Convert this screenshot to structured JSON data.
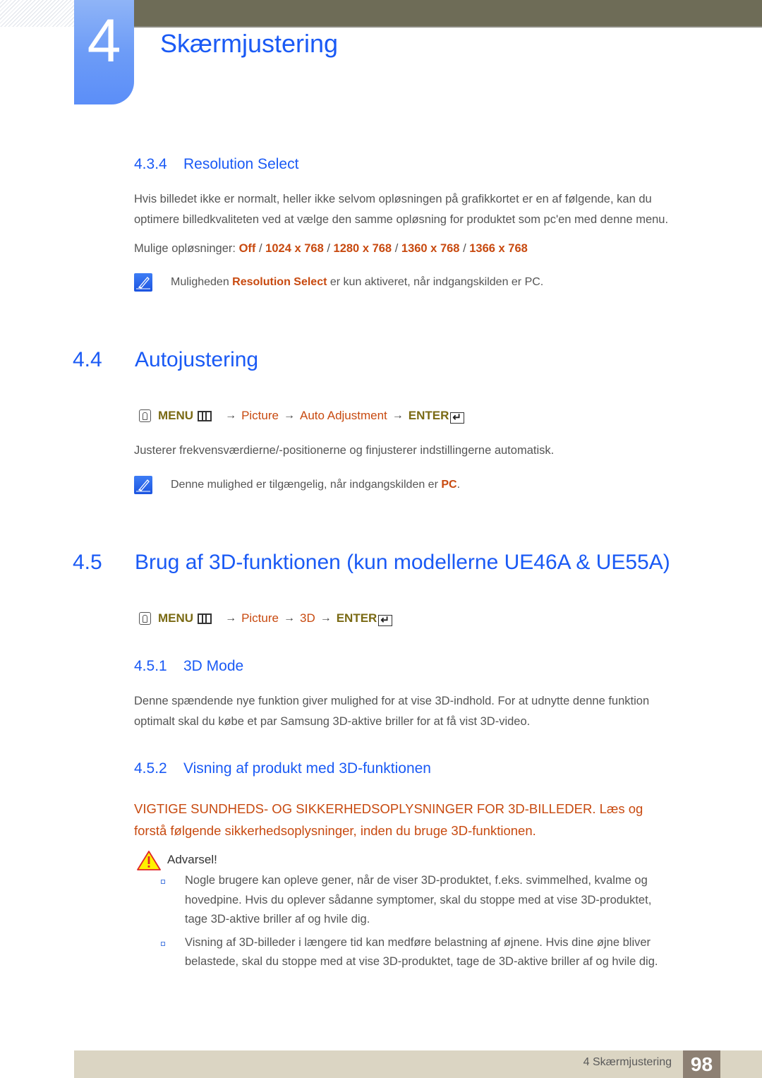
{
  "header": {
    "chapter_number": "4",
    "chapter_title": "Skærmjustering"
  },
  "section_434": {
    "number": "4.3.4",
    "title": "Resolution Select",
    "paragraph_line1": "Hvis billedet ikke er normalt, heller ikke selvom opløsningen på grafikkortet er en af følgende, kan du",
    "paragraph_line2": "optimere billedkvaliteten ved at vælge den samme opløsning for produktet som pc'en med denne menu.",
    "options_label": "Mulige opløsninger: ",
    "options": [
      "Off",
      "1024 x 768",
      "1280 x 768",
      "1360 x 768",
      "1366 x 768"
    ],
    "separator": " / ",
    "note": {
      "icon": "note-pencil-icon",
      "prefix": "Muligheden ",
      "highlight": "Resolution Select",
      "suffix": " er kun aktiveret, når indgangskilden er PC."
    }
  },
  "section_44": {
    "number": "4.4",
    "title": "Autojustering",
    "menu_path": {
      "menu": "MENU",
      "steps": [
        "Picture",
        "Auto Adjustment"
      ],
      "enter": "ENTER",
      "arrow": "→"
    },
    "paragraph": "Justerer frekvensværdierne/-positionerne og finjusterer indstillingerne automatisk.",
    "note": {
      "icon": "note-pencil-icon",
      "prefix": "Denne mulighed er tilgængelig, når indgangskilden er ",
      "highlight": "PC",
      "suffix": "."
    }
  },
  "section_45": {
    "number": "4.5",
    "title": "Brug af 3D-funktionen (kun modellerne UE46A & UE55A)",
    "menu_path": {
      "menu": "MENU",
      "steps": [
        "Picture",
        "3D"
      ],
      "enter": "ENTER",
      "arrow": "→"
    }
  },
  "section_451": {
    "number": "4.5.1",
    "title": "3D Mode",
    "paragraph_line1": "Denne spændende nye funktion giver mulighed for at vise 3D-indhold. For at udnytte denne funktion",
    "paragraph_line2": "optimalt skal du købe et par Samsung 3D-aktive briller for at få vist 3D-video."
  },
  "section_452": {
    "number": "4.5.2",
    "title": "Visning af produkt med 3D-funktionen",
    "warning_heading_line1": "VIGTIGE SUNDHEDS- OG SIKKERHEDSOPLYSNINGER FOR 3D-BILLEDER. Læs og",
    "warning_heading_line2": "forstå følgende sikkerhedsoplysninger, inden du bruge 3D-funktionen.",
    "caution_label": "Advarsel!",
    "bullets": [
      {
        "line1": "Nogle brugere kan opleve gener, når de viser 3D-produktet, f.eks. svimmelhed, kvalme og",
        "line2": "hovedpine. Hvis du oplever sådanne symptomer, skal du stoppe med at vise 3D-produktet,",
        "line3": "tage 3D-aktive briller af og hvile dig."
      },
      {
        "line1": "Visning af 3D-billeder i længere tid kan medføre belastning af øjnene. Hvis dine øjne bliver",
        "line2": "belastede, skal du stoppe med at vise 3D-produktet, tage de 3D-aktive briller af og hvile dig."
      }
    ]
  },
  "footer": {
    "chapter_label": "4 Skærmjustering",
    "page_number": "98"
  },
  "colors": {
    "heading_blue": "#1a5af5",
    "highlight_orange": "#c84a10",
    "menu_olive": "#7a6a14",
    "topbar": "#6e6c57",
    "footer_bg": "#dbd5c3",
    "footer_page_bg": "#8d8073"
  }
}
